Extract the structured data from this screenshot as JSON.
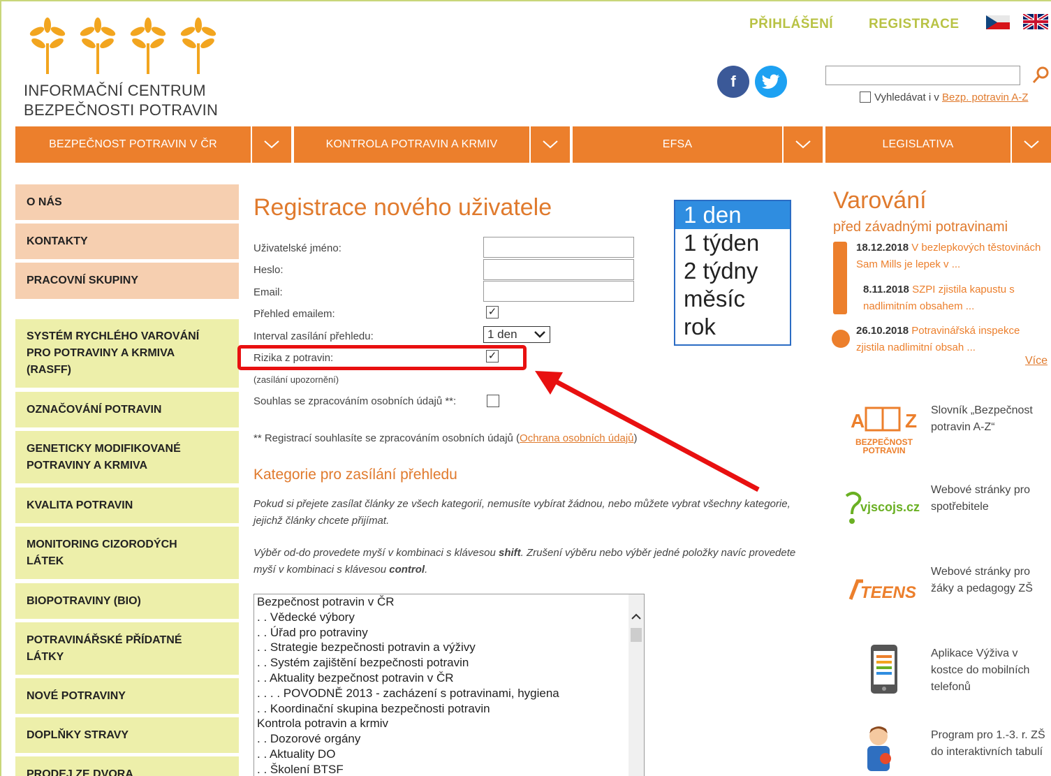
{
  "header": {
    "logo_line1": "INFORMAČNÍ CENTRUM",
    "logo_line2": "BEZPEČNOSTI POTRAVIN",
    "login": "PŘIHLÁŠENÍ",
    "register": "REGISTRACE",
    "search_checkbox_label": "Vyhledávat i v ",
    "search_checkbox_link": "Bezp. potravin A-Z",
    "facebook": "f",
    "twitter": "t"
  },
  "nav": [
    {
      "label": "BEZPEČNOST POTRAVIN V ČR"
    },
    {
      "label": "KONTROLA POTRAVIN A KRMIV"
    },
    {
      "label": "EFSA"
    },
    {
      "label": "LEGISLATIVA"
    }
  ],
  "sidebar": [
    {
      "label": "O NÁS"
    },
    {
      "label": "KONTAKTY"
    },
    {
      "label": "PRACOVNÍ SKUPINY"
    },
    {
      "label": "SYSTÉM RYCHLÉHO VAROVÁNÍ PRO POTRAVINY A KRMIVA (RASFF)"
    },
    {
      "label": "OZNAČOVÁNÍ POTRAVIN"
    },
    {
      "label": "GENETICKY MODIFIKOVANÉ POTRAVINY A KRMIVA"
    },
    {
      "label": "KVALITA POTRAVIN"
    },
    {
      "label": "MONITORING CIZORODÝCH LÁTEK"
    },
    {
      "label": "BIOPOTRAVINY (BIO)"
    },
    {
      "label": "POTRAVINÁŘSKÉ PŘÍDATNÉ LÁTKY"
    },
    {
      "label": "NOVÉ POTRAVINY"
    },
    {
      "label": "DOPLŇKY STRAVY"
    },
    {
      "label": "PRODEJ ZE DVORA"
    }
  ],
  "form": {
    "title": "Registrace nového uživatele",
    "username_label": "Uživatelské jméno:",
    "username_value": "",
    "password_label": "Heslo:",
    "password_value": "",
    "email_label": "Email:",
    "email_value": "",
    "overview_email_label": "Přehled emailem:",
    "overview_email_checked": "✓",
    "interval_label": "Interval zasílání přehledu:",
    "interval_value": "1 den",
    "risks_label": "Rizika z potravin:",
    "risks_checked": "✓",
    "risks_note": "(zasílání upozornění)",
    "consent_label": "Souhlas se zpracováním osobních údajů **:",
    "consent_note_prefix": "** Registrací souhlasíte se zpracováním osobních údajů (",
    "consent_note_link": "Ochrana osobních údajů",
    "consent_note_suffix": ")",
    "categories_title": "Kategorie pro zasílání přehledu",
    "categories_hint1": "Pokud si přejete zasílat články ze všech kategorií, nemusíte vybírat žádnou, nebo můžete vybrat všechny kategorie, jejichž články chcete přijímat.",
    "categories_hint2_a": "Výběr od-do provedete myší v kombinaci s klávesou ",
    "categories_hint2_b": "shift",
    "categories_hint2_c": ". Zrušení výběru nebo výběr jedné položky navíc provedete myší v kombinaci s klávesou ",
    "categories_hint2_d": "control",
    "categories_hint2_e": "."
  },
  "interval_options": [
    "1 den",
    "1 týden",
    "2 týdny",
    "měsíc",
    "rok"
  ],
  "categories": [
    "Bezpečnost potravin v ČR",
    ". . Vědecké výbory",
    ". . Úřad pro potraviny",
    ". . Strategie bezpečnosti potravin a výživy",
    ". . Systém zajištění bezpečnosti potravin",
    ". . Aktuality bezpečnost potravin v ČR",
    ". . . . POVODNĚ 2013 - zacházení s potravinami, hygiena",
    ". . Koordinační skupina bezpečnosti potravin",
    "Kontrola potravin a krmiv",
    ". . Dozorové orgány",
    ". . Aktuality DO",
    ". . Školení BTSF"
  ],
  "warnings": {
    "title": "Varování",
    "subtitle": "před závadnými potravinami",
    "items": [
      {
        "date": "18.12.2018",
        "text": " V bezlepkových těstovinách Sam Mills je lepek v ..."
      },
      {
        "date": "8.11.2018",
        "text": " SZPI zjistila kapustu s nadlimitním obsahem ..."
      },
      {
        "date": "26.10.2018",
        "text": " Potravinářská inspekce zjistila nadlimitní obsah ..."
      }
    ],
    "more": "Více"
  },
  "promos": [
    {
      "logo_text": "BEZPEČNOST POTRAVIN",
      "logo_a": "A",
      "logo_z": "Z",
      "text": "Slovník „Bezpečnost potravin A-Z“"
    },
    {
      "logo_text": "vjscojs.cz",
      "text": "Webové stránky pro spotřebitele"
    },
    {
      "logo_text": "TEENS",
      "text": "Webové stránky pro žáky a pedagogy ZŠ"
    },
    {
      "text": "Aplikace Výživa v kostce do mobilních telefonů"
    },
    {
      "text": "Program pro 1.-3. r. ZŠ do interaktivních tabulí"
    }
  ],
  "colors": {
    "accent": "#ec7f2c",
    "title": "#e07a2d",
    "topnav": "#b8c244",
    "sidebar_pink": "#f6cfb0",
    "sidebar_green": "#edefaa",
    "highlight": "#e81010"
  }
}
